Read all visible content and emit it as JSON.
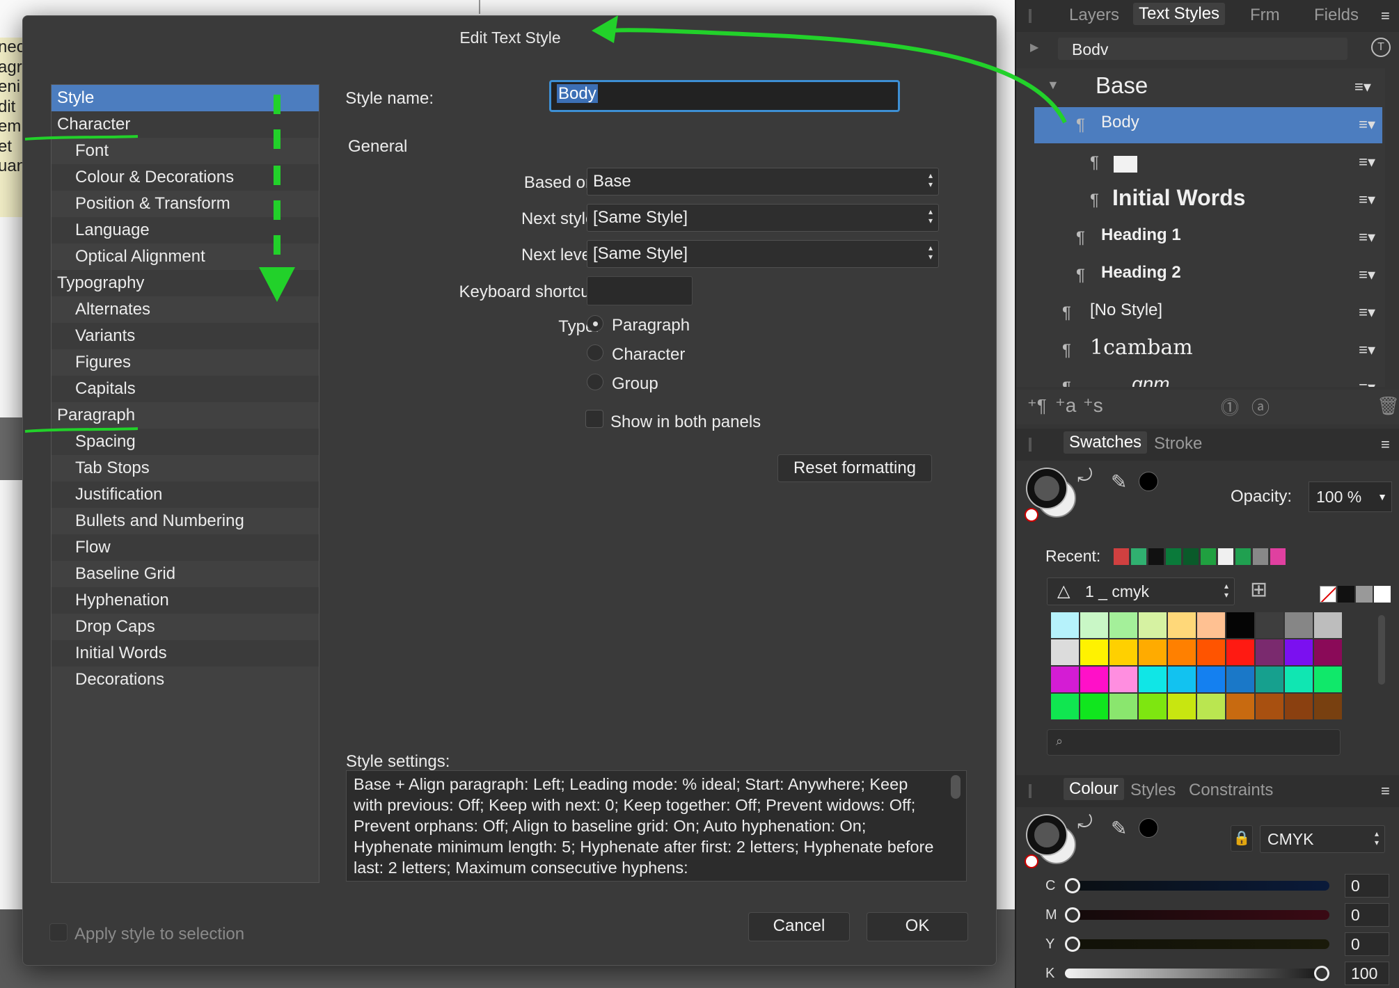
{
  "document": {
    "fragments": [
      "neo",
      "agr",
      "eni",
      "dit",
      "em",
      "",
      "",
      "et",
      "uan"
    ]
  },
  "dialog": {
    "title": "Edit Text Style",
    "nav": [
      {
        "label": "Style",
        "sub": false,
        "selected": true
      },
      {
        "label": "Character",
        "sub": false
      },
      {
        "label": "Font",
        "sub": true
      },
      {
        "label": "Colour & Decorations",
        "sub": true
      },
      {
        "label": "Position & Transform",
        "sub": true
      },
      {
        "label": "Language",
        "sub": true
      },
      {
        "label": "Optical Alignment",
        "sub": true
      },
      {
        "label": "Typography",
        "sub": false
      },
      {
        "label": "Alternates",
        "sub": true
      },
      {
        "label": "Variants",
        "sub": true
      },
      {
        "label": "Figures",
        "sub": true
      },
      {
        "label": "Capitals",
        "sub": true
      },
      {
        "label": "Paragraph",
        "sub": false
      },
      {
        "label": "Spacing",
        "sub": true
      },
      {
        "label": "Tab Stops",
        "sub": true
      },
      {
        "label": "Justification",
        "sub": true
      },
      {
        "label": "Bullets and Numbering",
        "sub": true
      },
      {
        "label": "Flow",
        "sub": true
      },
      {
        "label": "Baseline Grid",
        "sub": true
      },
      {
        "label": "Hyphenation",
        "sub": true
      },
      {
        "label": "Drop Caps",
        "sub": true
      },
      {
        "label": "Initial Words",
        "sub": true
      },
      {
        "label": "Decorations",
        "sub": true
      }
    ],
    "style_name_label": "Style name:",
    "style_name_value": "Body",
    "general_heading": "General",
    "based_on_label": "Based on:",
    "based_on_value": "Base",
    "next_style_label": "Next style:",
    "next_style_value": "[Same Style]",
    "next_level_label": "Next level:",
    "next_level_value": "[Same Style]",
    "keyboard_shortcut_label": "Keyboard shortcut:",
    "keyboard_shortcut_value": "",
    "type_label": "Type:",
    "type_options": [
      "Paragraph",
      "Character",
      "Group"
    ],
    "type_selected": "Paragraph",
    "show_both_label": "Show in both panels",
    "reset_label": "Reset formatting",
    "style_settings_label": "Style settings:",
    "style_settings_text": "Base + Align paragraph: Left; Leading mode: % ideal; Start: Anywhere; Keep with previous: Off; Keep with next: 0; Keep together: Off; Prevent widows: Off; Prevent orphans: Off; Align to baseline grid: On; Auto hyphenation: On; Hyphenate minimum length: 5; Hyphenate after first: 2 letters; Hyphenate before last: 2 letters; Maximum consecutive hyphens:",
    "apply_label": "Apply style to selection",
    "cancel_label": "Cancel",
    "ok_label": "OK"
  },
  "text_styles_panel": {
    "tabs": [
      "Layers",
      "Text Styles",
      "Frm",
      "Fields"
    ],
    "active_tab": "Text Styles",
    "current_style": "Bodv",
    "group_label": "Base",
    "rows": [
      {
        "name": "Body",
        "selected": true
      },
      {
        "name": ""
      },
      {
        "name": "Initial Words"
      },
      {
        "name": "Heading 1"
      },
      {
        "name": "Heading 2"
      },
      {
        "name": "[No Style]"
      },
      {
        "name": "1cambam"
      },
      {
        "name": "gnm"
      }
    ],
    "footer_icons": [
      "new-paragraph-style-icon",
      "new-character-style-icon",
      "new-group-style-icon",
      "paragraph-icon",
      "character-icon",
      "delete-icon"
    ]
  },
  "swatches_panel": {
    "tabs": [
      "Swatches",
      "Stroke"
    ],
    "active_tab": "Swatches",
    "opacity_label": "Opacity:",
    "opacity_value": "100 %",
    "recent_label": "Recent:",
    "recent_colors": [
      "#d04040",
      "#30b070",
      "#111111",
      "#0a7a3a",
      "#0a5a2a",
      "#20a040",
      "#f0f0f0",
      "#20a050",
      "#888888",
      "#e040a0"
    ],
    "palette_name": "1 _ cmyk",
    "palette_colors": [
      [
        "#b6f2fb",
        "#c9f7c6",
        "#a4f09a",
        "#d6f2a2",
        "#ffd879",
        "#ffc192",
        "#050505",
        "#3e3e3e",
        "#868686",
        "#bdbdbd"
      ],
      [
        "#dcdcdc",
        "#fff200",
        "#ffd000",
        "#ffab00",
        "#ff8000",
        "#ff5400",
        "#ff1a12",
        "#7a2a6e",
        "#7b10f0",
        "#8a0a58"
      ],
      [
        "#d41cd4",
        "#ff10c8",
        "#ff8ee0",
        "#10e6e6",
        "#12c2f0",
        "#1480f0",
        "#1a78c8",
        "#16a08e",
        "#10e6b2",
        "#10e86a"
      ],
      [
        "#10e650",
        "#10e61e",
        "#8ae66e",
        "#7ee610",
        "#c8e610",
        "#bae650",
        "#c86a10",
        "#a85010",
        "#8a4010",
        "#784010"
      ]
    ]
  },
  "colour_panel": {
    "tabs": [
      "Colour",
      "Styles",
      "Constraints"
    ],
    "active_tab": "Colour",
    "model": "CMYK",
    "channels": [
      {
        "label": "C",
        "value": "0",
        "level": 0
      },
      {
        "label": "M",
        "value": "0",
        "level": 0
      },
      {
        "label": "Y",
        "value": "0",
        "level": 0
      },
      {
        "label": "K",
        "value": "100",
        "level": 1
      }
    ]
  }
}
